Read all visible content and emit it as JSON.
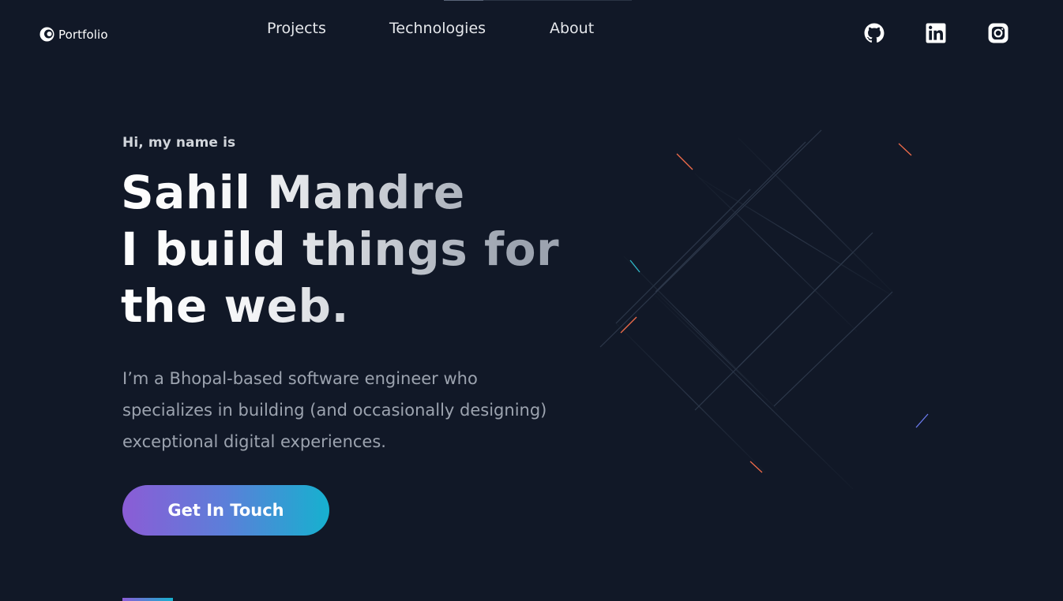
{
  "header": {
    "brand": {
      "label": "Portfolio",
      "icon": "portfolio-logo-icon"
    },
    "nav": [
      {
        "label": "Projects"
      },
      {
        "label": "Technologies"
      },
      {
        "label": "About"
      }
    ],
    "socials": [
      {
        "name": "github-icon"
      },
      {
        "name": "linkedin-icon"
      },
      {
        "name": "instagram-icon"
      }
    ]
  },
  "hero": {
    "intro": "Hi, my name is",
    "headline": {
      "line1": "Sahil Mandre",
      "line2": "I build things for",
      "line3": "the web."
    },
    "bio": "I’m a Bhopal-based software engineer who specializes in building (and occasionally designing) exceptional digital experiences.",
    "cta_label": "Get In Touch"
  },
  "colors": {
    "background": "#111827",
    "gradient_start": "#8b5cd6",
    "gradient_end": "#16b1cf",
    "text_muted": "#9ca3af"
  }
}
